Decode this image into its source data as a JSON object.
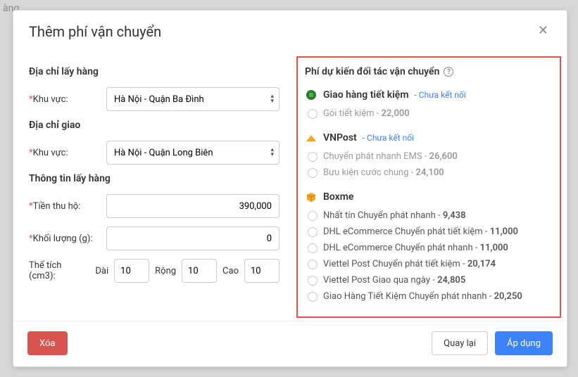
{
  "bg_text": "àng",
  "modal": {
    "title": "Thêm phí vận chuyển",
    "close": "✕"
  },
  "left": {
    "pickup_title": "Địa chỉ lấy hàng",
    "area_label": "Khu vực:",
    "pickup_area_value": "Hà Nội - Quận Ba Đình",
    "delivery_title": "Địa chỉ giao",
    "delivery_area_value": "Hà Nội - Quận Long Biên",
    "info_title": "Thông tin lấy hàng",
    "cod_label": "Tiền thu hộ:",
    "cod_value": "390,000",
    "weight_label": "Khối lượng (g):",
    "weight_value": "0",
    "volume_label": "Thể tích (cm3):",
    "dai": "Dài",
    "dai_val": "10",
    "rong": "Rộng",
    "rong_val": "10",
    "cao": "Cao",
    "cao_val": "10"
  },
  "right": {
    "title": "Phí dự kiến đối tác vận chuyển",
    "not_connected": "- Chưa kết nối",
    "partners": [
      {
        "name": "Giao hàng tiết kiệm",
        "icon": "ghtk",
        "connected": false,
        "options": [
          {
            "label": "Gói tiết kiệm",
            "price": "22,000",
            "muted": true
          }
        ]
      },
      {
        "name": "VNPost",
        "icon": "vnpost",
        "connected": false,
        "options": [
          {
            "label": "Chuyển phát nhanh EMS",
            "price": "26,600",
            "muted": true
          },
          {
            "label": "Bưu kiện cước chung",
            "price": "24,100",
            "muted": true
          }
        ]
      },
      {
        "name": "Boxme",
        "icon": "boxme",
        "connected": true,
        "options": [
          {
            "label": "Nhất tín Chuyển phát nhanh",
            "price": "9,438"
          },
          {
            "label": "DHL eCommerce Chuyển phát tiết kiệm",
            "price": "11,000"
          },
          {
            "label": "DHL eCommerce Chuyển phát nhanh",
            "price": "11,000"
          },
          {
            "label": "Viettel Post Chuyển phát tiết kiệm",
            "price": "20,174"
          },
          {
            "label": "Viettel Post Giao qua ngày",
            "price": "24,805"
          },
          {
            "label": "Giao Hàng Tiết Kiệm Chuyển phát nhanh",
            "price": "20,250"
          }
        ]
      }
    ]
  },
  "footer": {
    "delete": "Xóa",
    "back": "Quay lại",
    "apply": "Áp dụng"
  }
}
